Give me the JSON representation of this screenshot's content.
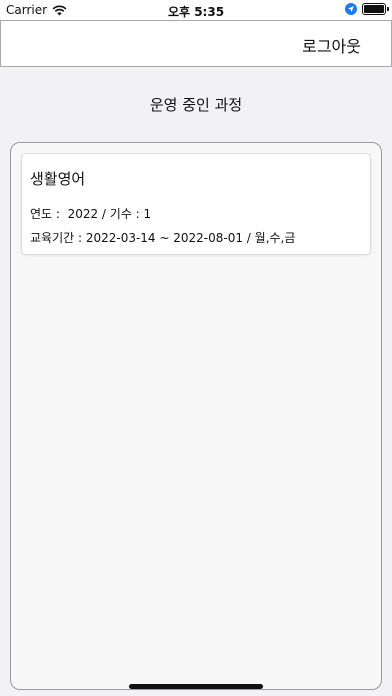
{
  "status_bar": {
    "carrier": "Carrier",
    "time": "오후 5:35"
  },
  "header": {
    "logout_label": "로그아웃"
  },
  "main": {
    "title": "운영 중인 과정",
    "courses": [
      {
        "name": "생활영어",
        "year_line": "연도 :  2022 / 기수 : 1",
        "period_line": "교육기간 : 2022-03-14 ~ 2022-08-01 / 월,수,금"
      }
    ]
  },
  "colors": {
    "background": "#f2f2f4",
    "location_icon": "#1a7cf0"
  }
}
